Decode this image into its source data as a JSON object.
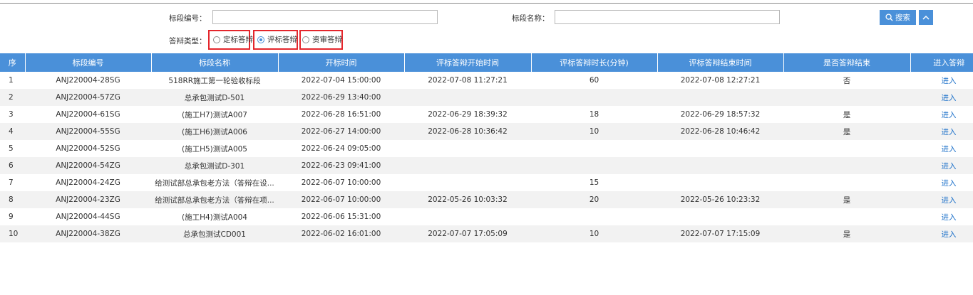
{
  "filters": {
    "section_code_label": "标段编号：",
    "section_code_value": "",
    "section_name_label": "标段名称：",
    "section_name_value": "",
    "search_label": "搜索",
    "type_label": "答辩类型：",
    "options": [
      "定标答辩",
      "评标答辩",
      "资审答辩"
    ],
    "selected": "评标答辩"
  },
  "table": {
    "headers": [
      "序",
      "标段编号",
      "标段名称",
      "开标时间",
      "评标答辩开始时间",
      "评标答辩时长(分钟)",
      "评标答辩结束时间",
      "是否答辩结束",
      "进入答辩"
    ],
    "rows": [
      [
        "1",
        "ANJ220004-28SG",
        "518RR施工第一轮验收标段",
        "2022-07-04 15:00:00",
        "2022-07-08 11:27:21",
        "60",
        "2022-07-08 12:27:21",
        "否",
        "进入"
      ],
      [
        "2",
        "ANJ220004-57ZG",
        "总承包测试D-501",
        "2022-06-29 13:40:00",
        "",
        "",
        "",
        "",
        "进入"
      ],
      [
        "3",
        "ANJ220004-61SG",
        "(施工H7)测试A007",
        "2022-06-28 16:51:00",
        "2022-06-29 18:39:32",
        "18",
        "2022-06-29 18:57:32",
        "是",
        "进入"
      ],
      [
        "4",
        "ANJ220004-55SG",
        "(施工H6)测试A006",
        "2022-06-27 14:00:00",
        "2022-06-28 10:36:42",
        "10",
        "2022-06-28 10:46:42",
        "是",
        "进入"
      ],
      [
        "5",
        "ANJ220004-52SG",
        "(施工H5)测试A005",
        "2022-06-24 09:05:00",
        "",
        "",
        "",
        "",
        "进入"
      ],
      [
        "6",
        "ANJ220004-54ZG",
        "总承包测试D-301",
        "2022-06-23 09:41:00",
        "",
        "",
        "",
        "",
        "进入"
      ],
      [
        "7",
        "ANJ220004-24ZG",
        "给测试部总承包老方法（答辩在设...",
        "2022-06-07 10:00:00",
        "",
        "15",
        "",
        "",
        "进入"
      ],
      [
        "8",
        "ANJ220004-23ZG",
        "给测试部总承包老方法（答辩在项...",
        "2022-06-07 10:00:00",
        "2022-05-26 10:03:32",
        "20",
        "2022-05-26 10:23:32",
        "是",
        "进入"
      ],
      [
        "9",
        "ANJ220004-44SG",
        "(施工H4)测试A004",
        "2022-06-06 15:31:00",
        "",
        "",
        "",
        "",
        "进入"
      ],
      [
        "10",
        "ANJ220004-38ZG",
        "总承包测试CD001",
        "2022-06-02 16:01:00",
        "2022-07-07 17:05:09",
        "10",
        "2022-07-07 17:15:09",
        "是",
        "进入"
      ]
    ]
  },
  "colors": {
    "accent": "#4a90d9",
    "highlight_box": "#e4262c",
    "link": "#1a6fc9",
    "row_alt": "#f2f2f2"
  },
  "icons": {
    "search": "search-icon",
    "collapse": "chevron-up-icon"
  }
}
